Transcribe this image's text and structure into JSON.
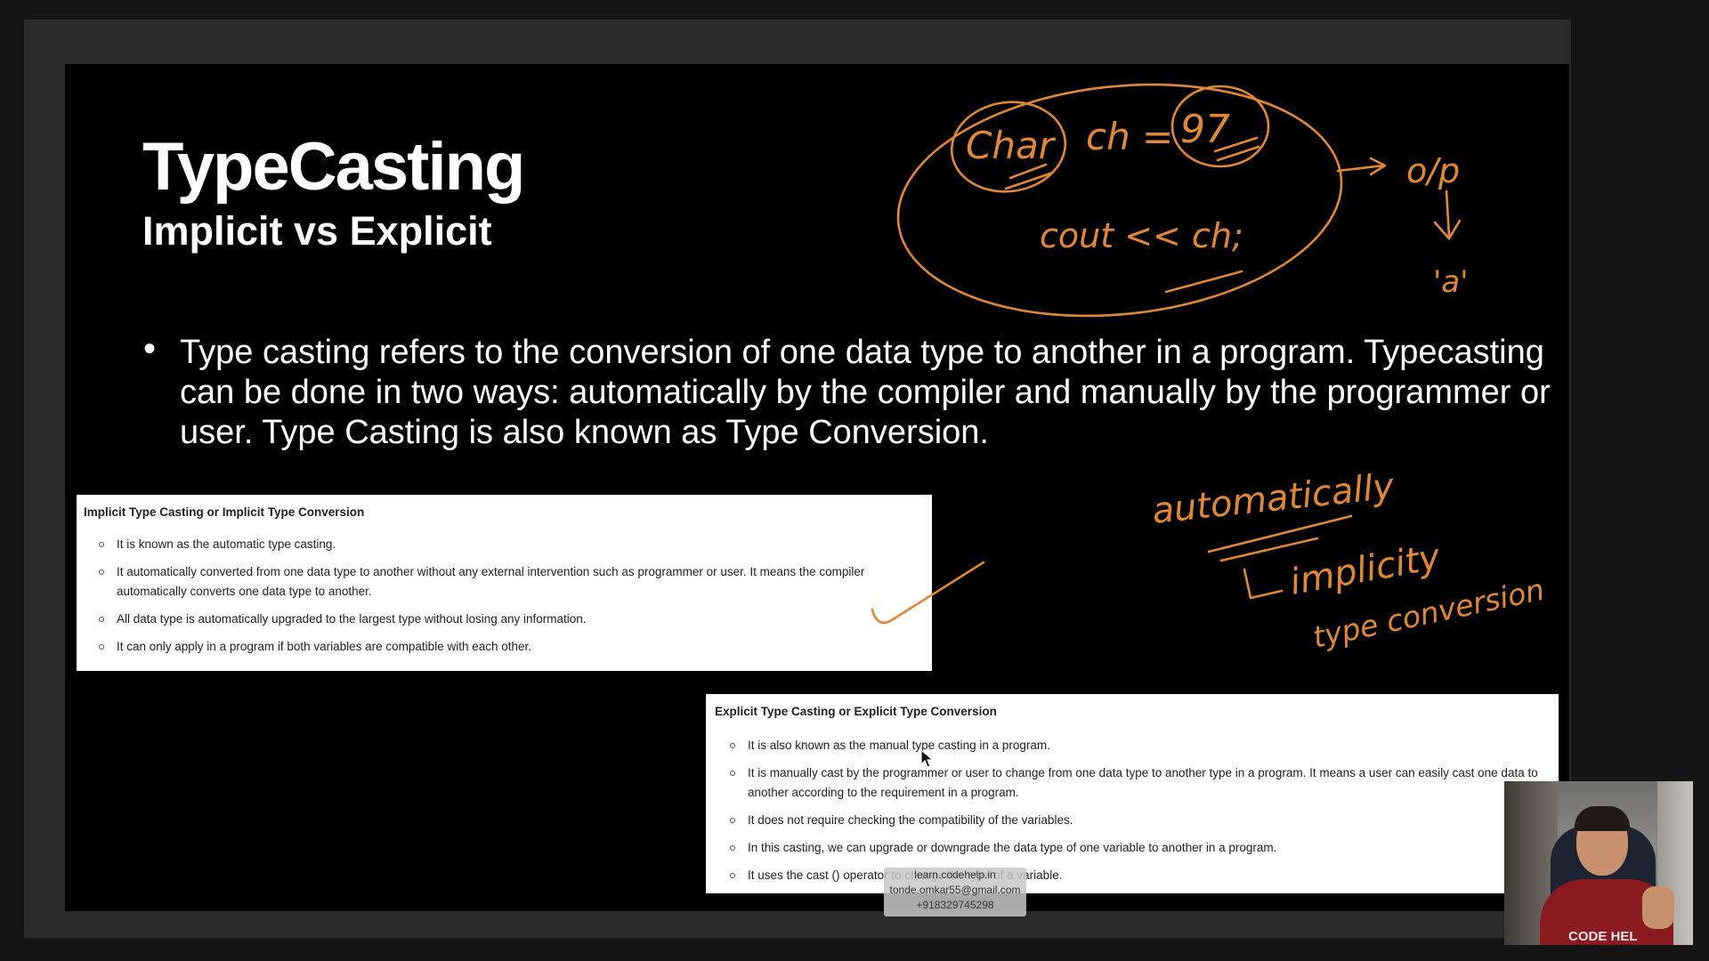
{
  "slide": {
    "title": "TypeCasting",
    "subtitle": "Implicit vs Explicit",
    "bullet_symbol": "•",
    "bullet_text": "Type casting refers to the conversion of one data type to another in a program. Typecasting can be done in two ways: automatically by the compiler and manually by the programmer or user. Type Casting is also known as Type Conversion."
  },
  "implicit_card": {
    "heading": "Implicit Type Casting or Implicit Type Conversion",
    "items": [
      "It is known as the automatic type casting.",
      "It automatically converted from one data type to another without any external intervention such as programmer or user. It means the compiler automatically converts one data type to another.",
      "All data type is automatically upgraded to the largest type without losing any information.",
      "It can only apply in a program if both variables are compatible with each other."
    ]
  },
  "explicit_card": {
    "heading": "Explicit Type Casting or Explicit Type Conversion",
    "items": [
      "It is also known as the manual type casting in a program.",
      "It is manually cast by the programmer or user to change from one data type to another type in a program. It means a user can easily cast one data to another according to the requirement in a program.",
      "It does not require checking the compatibility of the variables.",
      "In this casting, we can upgrade or downgrade the data type of one variable to another in a program.",
      "It uses the cast () operator to change the type of a variable."
    ]
  },
  "annotations": {
    "code_line_1_type": "Char",
    "code_line_1_var": "ch",
    "code_line_1_op": "=",
    "code_line_1_val": "97",
    "code_line_2": "cout << ch;",
    "output_label": "o/p",
    "output_value": "'a'",
    "note_1": "automatically",
    "note_2": "implicity",
    "note_3": "type conversion",
    "ink_color": "#e08836"
  },
  "watermark": {
    "line1": "learn.codehelp.in",
    "line2": "tonde.omkar55@gmail.com",
    "line3": "+918329745298"
  },
  "webcam": {
    "shirt_logo": "CODE HEL"
  }
}
